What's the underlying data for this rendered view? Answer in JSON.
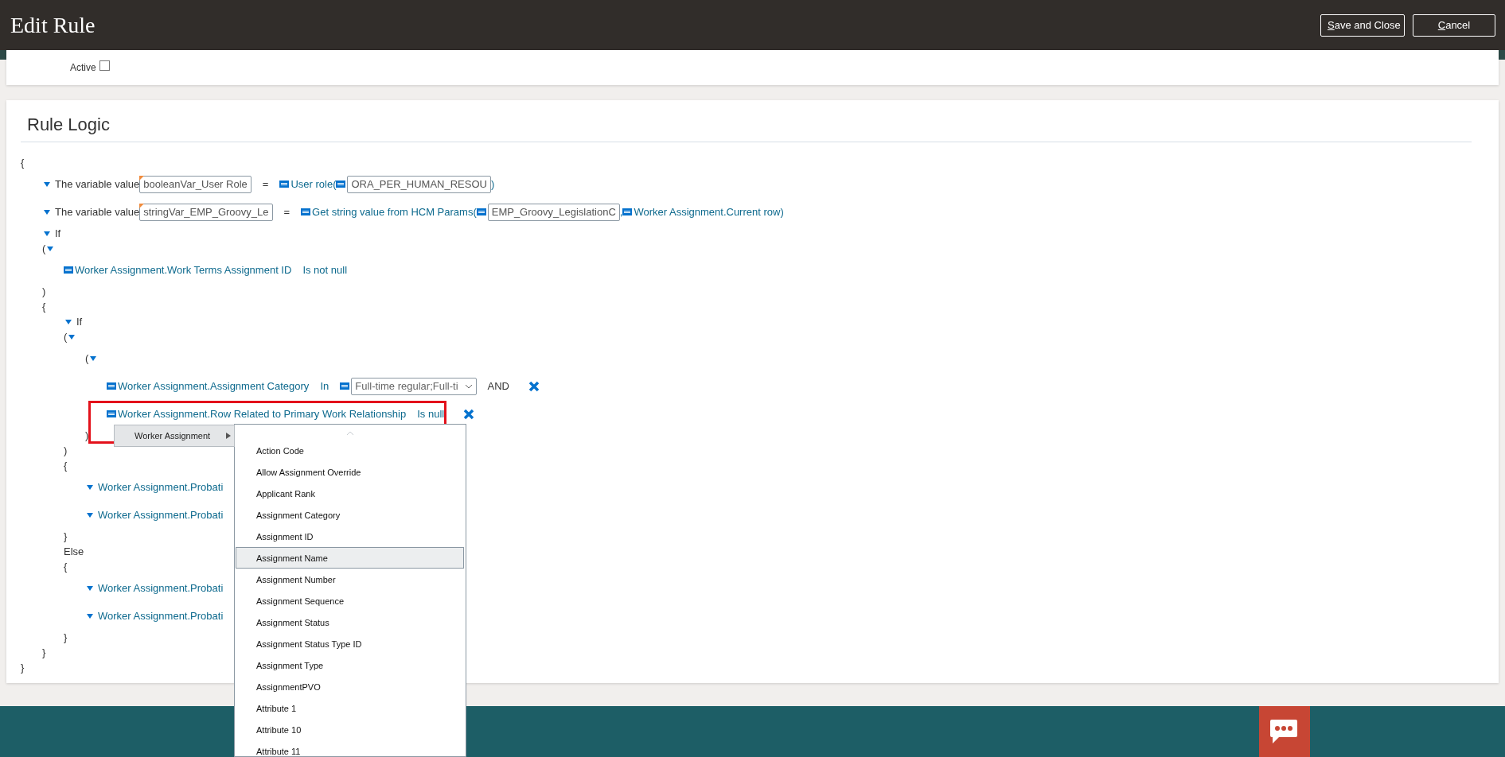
{
  "window": {
    "title": "Edit Rule"
  },
  "header_buttons": [
    {
      "label": "Save and Close"
    },
    {
      "label": "Cancel"
    }
  ],
  "active": {
    "label": "Active",
    "checked": false
  },
  "rule_logic": {
    "title": "Rule Logic",
    "lines": [
      {
        "parts": [
          {
            "kind": "text",
            "text": "{"
          }
        ],
        "children": [
          {
            "kind": "expr",
            "parts": [
              {
                "kind": "caret",
                "expanded": true
              },
              {
                "kind": "text",
                "text": "The variable value"
              },
              {
                "kind": "field",
                "value": "booleanVar_User Role",
                "flagged": true
              },
              {
                "kind": "op",
                "text": "="
              },
              {
                "kind": "var"
              },
              {
                "kind": "link",
                "text": "User role("
              },
              {
                "kind": "var"
              },
              {
                "kind": "field",
                "value": "ORA_PER_HUMAN_RESOU",
                "flagged": false
              },
              {
                "kind": "link",
                "text": ")"
              }
            ]
          },
          {
            "kind": "expr",
            "parts": [
              {
                "kind": "caret",
                "expanded": true
              },
              {
                "kind": "text",
                "text": "The variable value"
              },
              {
                "kind": "field",
                "value": "stringVar_EMP_Groovy_Le",
                "flagged": true
              },
              {
                "kind": "op",
                "text": "="
              },
              {
                "kind": "var"
              },
              {
                "kind": "link",
                "text": "Get string value from HCM Params("
              },
              {
                "kind": "var"
              },
              {
                "kind": "field",
                "value": "EMP_Groovy_LegislationC",
                "flagged": false
              },
              {
                "kind": "link",
                "text": ","
              },
              {
                "kind": "var"
              },
              {
                "kind": "link",
                "text": "Worker Assignment.Current row)"
              }
            ]
          },
          {
            "parts": [
              {
                "kind": "caret",
                "expanded": true
              },
              {
                "kind": "text",
                "text": "If"
              }
            ]
          },
          {
            "parts": [
              {
                "kind": "text",
                "text": "("
              },
              {
                "kind": "caret",
                "expanded": true
              }
            ],
            "children": [
              {
                "kind": "expr",
                "parts": [
                  {
                    "kind": "var"
                  },
                  {
                    "kind": "link",
                    "text": "Worker Assignment.Work Terms Assignment ID"
                  },
                  {
                    "kind": "keyword",
                    "text": "Is not null"
                  }
                ]
              }
            ]
          },
          {
            "parts": [
              {
                "kind": "text",
                "text": ")"
              }
            ]
          },
          {
            "parts": [
              {
                "kind": "text",
                "text": "{"
              }
            ],
            "children": [
              {
                "parts": [
                  {
                    "kind": "caret",
                    "expanded": true
                  },
                  {
                    "kind": "text",
                    "text": "If"
                  }
                ]
              },
              {
                "parts": [
                  {
                    "kind": "text",
                    "text": "("
                  },
                  {
                    "kind": "caret",
                    "expanded": true
                  }
                ],
                "children": [
                  {
                    "kind": "expr",
                    "parts": [
                      {
                        "kind": "text",
                        "text": "("
                      },
                      {
                        "kind": "caret",
                        "expanded": true
                      }
                    ],
                    "children": [
                      {
                        "kind": "expr",
                        "parts": [
                          {
                            "kind": "var"
                          },
                          {
                            "kind": "link",
                            "text": "Worker Assignment.Assignment Category"
                          },
                          {
                            "kind": "keyword",
                            "text": "In"
                          },
                          {
                            "kind": "var"
                          },
                          {
                            "kind": "select",
                            "value": "Full-time regular;Full-ti"
                          },
                          {
                            "kind": "op",
                            "text": "AND"
                          },
                          {
                            "kind": "remove"
                          }
                        ]
                      },
                      {
                        "kind": "expr",
                        "parts": [
                          {
                            "kind": "var"
                          },
                          {
                            "kind": "link",
                            "text": "Worker Assignment.Row Related to Primary Work Relationship"
                          },
                          {
                            "kind": "keyword",
                            "text": "Is null"
                          },
                          {
                            "kind": "remove"
                          }
                        ]
                      }
                    ]
                  },
                  {
                    "parts": [
                      {
                        "kind": "text",
                        "text": ")"
                      }
                    ]
                  }
                ]
              },
              {
                "parts": [
                  {
                    "kind": "text",
                    "text": ")"
                  }
                ]
              },
              {
                "parts": [
                  {
                    "kind": "text",
                    "text": "{"
                  }
                ],
                "children": [
                  {
                    "kind": "expr",
                    "parts": [
                      {
                        "kind": "caret",
                        "expanded": true
                      },
                      {
                        "kind": "link",
                        "text": "Worker Assignment.Probati"
                      }
                    ]
                  },
                  {
                    "kind": "expr",
                    "parts": [
                      {
                        "kind": "caret",
                        "expanded": true
                      },
                      {
                        "kind": "link",
                        "text": "Worker Assignment.Probati"
                      }
                    ]
                  }
                ]
              },
              {
                "parts": [
                  {
                    "kind": "text",
                    "text": "}"
                  }
                ]
              },
              {
                "parts": [
                  {
                    "kind": "text",
                    "text": "Else"
                  }
                ]
              },
              {
                "parts": [
                  {
                    "kind": "text",
                    "text": "{"
                  }
                ],
                "children": [
                  {
                    "kind": "expr",
                    "parts": [
                      {
                        "kind": "caret",
                        "expanded": true
                      },
                      {
                        "kind": "link",
                        "text": "Worker Assignment.Probati"
                      }
                    ]
                  },
                  {
                    "kind": "expr",
                    "parts": [
                      {
                        "kind": "caret",
                        "expanded": true
                      },
                      {
                        "kind": "link",
                        "text": "Worker Assignment.Probati"
                      }
                    ]
                  }
                ]
              },
              {
                "parts": [
                  {
                    "kind": "text",
                    "text": "}"
                  }
                ]
              }
            ]
          },
          {
            "parts": [
              {
                "kind": "text",
                "text": "}"
              }
            ]
          }
        ]
      },
      {
        "parts": [
          {
            "kind": "text",
            "text": "}"
          }
        ]
      }
    ]
  },
  "menu": {
    "submenu": {
      "label": "Worker Assignment"
    },
    "items": [
      {
        "label": "Action Code",
        "selected": false
      },
      {
        "label": "Allow Assignment Override",
        "selected": false
      },
      {
        "label": "Applicant Rank",
        "selected": false
      },
      {
        "label": "Assignment Category",
        "selected": false
      },
      {
        "label": "Assignment ID",
        "selected": false
      },
      {
        "label": "Assignment Name",
        "selected": true
      },
      {
        "label": "Assignment Number",
        "selected": false
      },
      {
        "label": "Assignment Sequence",
        "selected": false
      },
      {
        "label": "Assignment Status",
        "selected": false
      },
      {
        "label": "Assignment Status Type ID",
        "selected": false
      },
      {
        "label": "Assignment Type",
        "selected": false
      },
      {
        "label": "AssignmentPVO",
        "selected": false
      },
      {
        "label": "Attribute 1",
        "selected": false
      },
      {
        "label": "Attribute 10",
        "selected": false
      },
      {
        "label": "Attribute 11",
        "selected": false
      }
    ]
  }
}
